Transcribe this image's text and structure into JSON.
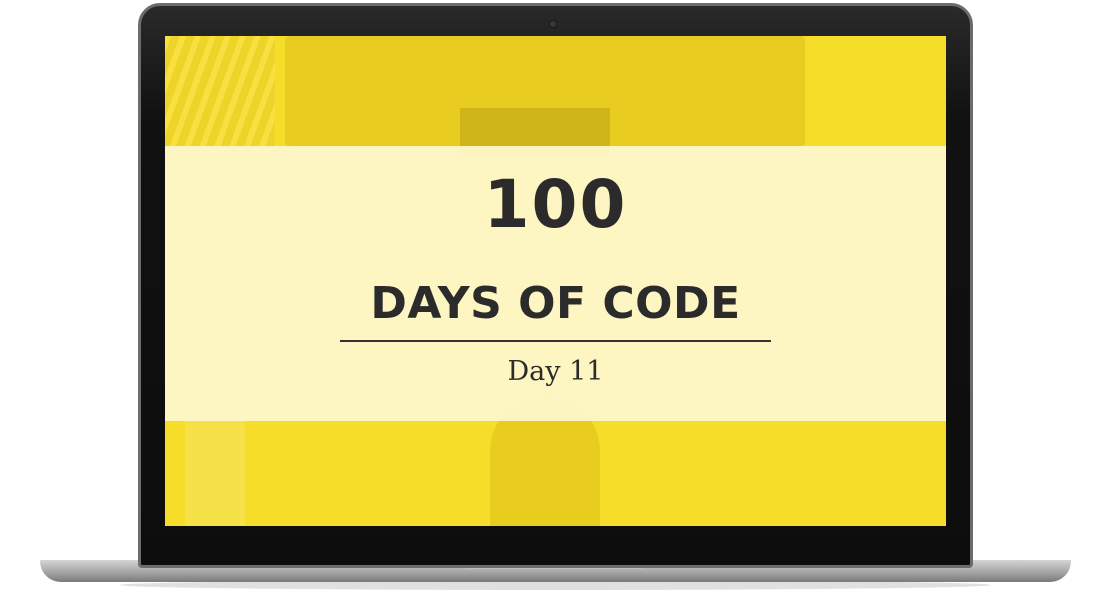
{
  "thumbnail": {
    "title_number": "100",
    "title_main": "DAYS OF CODE",
    "subtitle": "Day 11"
  },
  "colors": {
    "screen_background": "#f6dd2a",
    "title_band": "#fdf8cd",
    "text": "#2b2b2b",
    "bezel": "#111111"
  }
}
